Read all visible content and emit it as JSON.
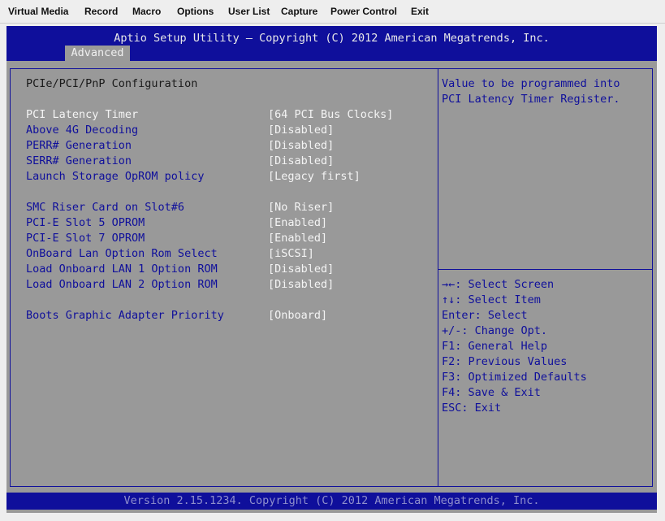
{
  "menubar": {
    "items": [
      "Virtual Media",
      "Record",
      "Macro",
      "Options",
      "User List",
      "Capture",
      "Power Control",
      "Exit"
    ]
  },
  "header": {
    "title": "Aptio Setup Utility – Copyright (C) 2012 American Megatrends, Inc.",
    "active_tab": "Advanced"
  },
  "main": {
    "section_title": "PCIe/PCI/PnP Configuration",
    "settings": [
      {
        "label": "PCI Latency Timer",
        "value": "[64 PCI Bus Clocks]",
        "selected": true
      },
      {
        "label": "Above 4G Decoding",
        "value": "[Disabled]"
      },
      {
        "label": "PERR# Generation",
        "value": "[Disabled]"
      },
      {
        "label": "SERR# Generation",
        "value": "[Disabled]"
      },
      {
        "label": "Launch Storage OpROM policy",
        "value": "[Legacy first]"
      },
      {
        "label": "SMC Riser Card on Slot#6",
        "value": "[No Riser]"
      },
      {
        "label": "PCI-E Slot 5 OPROM",
        "value": "[Enabled]"
      },
      {
        "label": "PCI-E Slot 7 OPROM",
        "value": "[Enabled]"
      },
      {
        "label": "OnBoard Lan Option Rom Select",
        "value": "[iSCSI]"
      },
      {
        "label": "Load Onboard LAN 1 Option ROM",
        "value": "[Disabled]"
      },
      {
        "label": "Load Onboard LAN 2 Option ROM",
        "value": "[Disabled]"
      },
      {
        "label": "Boots Graphic Adapter Priority",
        "value": "[Onboard]"
      }
    ]
  },
  "help": {
    "lines": [
      "Value to be programmed into",
      "PCI Latency Timer Register."
    ],
    "keys": [
      "→←: Select Screen",
      "↑↓: Select Item",
      "Enter: Select",
      "+/-: Change Opt.",
      "F1: General Help",
      "F2: Previous Values",
      "F3: Optimized Defaults",
      "F4: Save & Exit",
      "ESC: Exit"
    ]
  },
  "footer": {
    "text": "Version 2.15.1234. Copyright (C) 2012 American Megatrends, Inc."
  },
  "colors": {
    "bios_blue": "#0f0f9b",
    "bios_gray": "#999999",
    "highlight_white": "#f4f4f4",
    "footer_text": "#8f8fcc"
  }
}
